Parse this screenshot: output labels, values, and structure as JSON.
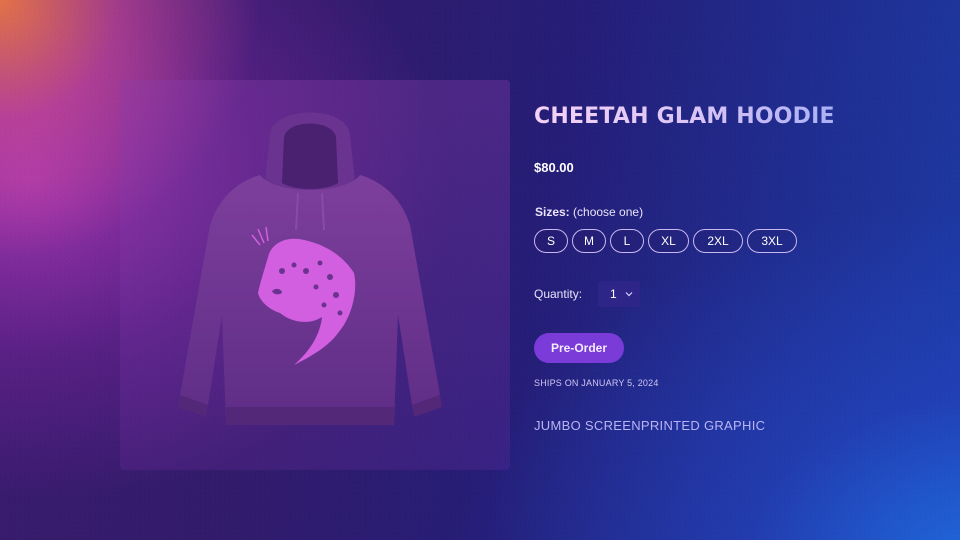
{
  "product": {
    "title": "CHEETAH GLAM HOODIE",
    "price": "$80.00",
    "image_icon": "hoodie-with-cheetah-graphic",
    "sizes_label": "Sizes:",
    "sizes_hint": "(choose one)",
    "sizes": [
      "S",
      "M",
      "L",
      "XL",
      "2XL",
      "3XL"
    ],
    "quantity_label": "Quantity:",
    "quantity_value": "1",
    "preorder_label": "Pre-Order",
    "ships_text": "SHIPS ON JANUARY 5, 2024",
    "description": "JUMBO SCREENPRINTED GRAPHIC"
  },
  "colors": {
    "accent": "#7a3bd8",
    "size_border": "#c9b8f2",
    "quantity_bg": "#2d2688",
    "description_text": "#b9b4f6"
  }
}
